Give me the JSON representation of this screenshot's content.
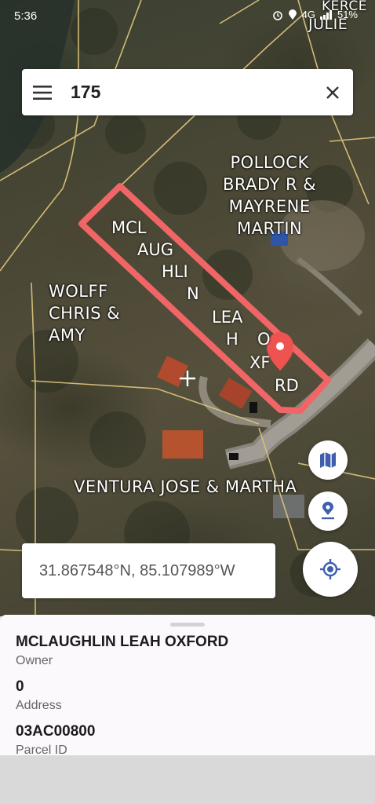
{
  "status_bar": {
    "time": "5:36",
    "network": "4G",
    "battery": "51%"
  },
  "search": {
    "query": "175"
  },
  "map": {
    "labels": {
      "pollock": [
        "POLLOCK",
        "BRADY R &",
        "MAYRENE",
        "MARTIN"
      ],
      "wolff": [
        "WOLFF",
        "CHRIS &",
        "AMY"
      ],
      "ventura": "VENTURA JOSE & MARTHA",
      "julie": "JULIE",
      "kerce": "KERCE",
      "parcel_fragments": [
        "MCL",
        "AUG",
        "HLI",
        "N",
        "LEA",
        "H",
        "O",
        "XF",
        "RD"
      ]
    },
    "colors": {
      "parcel_outline": "#f06565",
      "property_lines": "#d9c27a",
      "marker": "#ef5350",
      "icon_blue": "#3f5fae"
    }
  },
  "coordinates": "31.867548°N, 85.107989°W",
  "icons": {
    "menu": "menu-icon",
    "clear": "close-icon",
    "layers": "map-icon",
    "pin": "location-pin-icon",
    "locate": "my-location-icon"
  },
  "parcel": {
    "owner_value": "MCLAUGHLIN LEAH OXFORD",
    "owner_label": "Owner",
    "address_value": "0",
    "address_label": "Address",
    "parcel_id_value": "03AC00800",
    "parcel_id_label": "Parcel ID"
  }
}
